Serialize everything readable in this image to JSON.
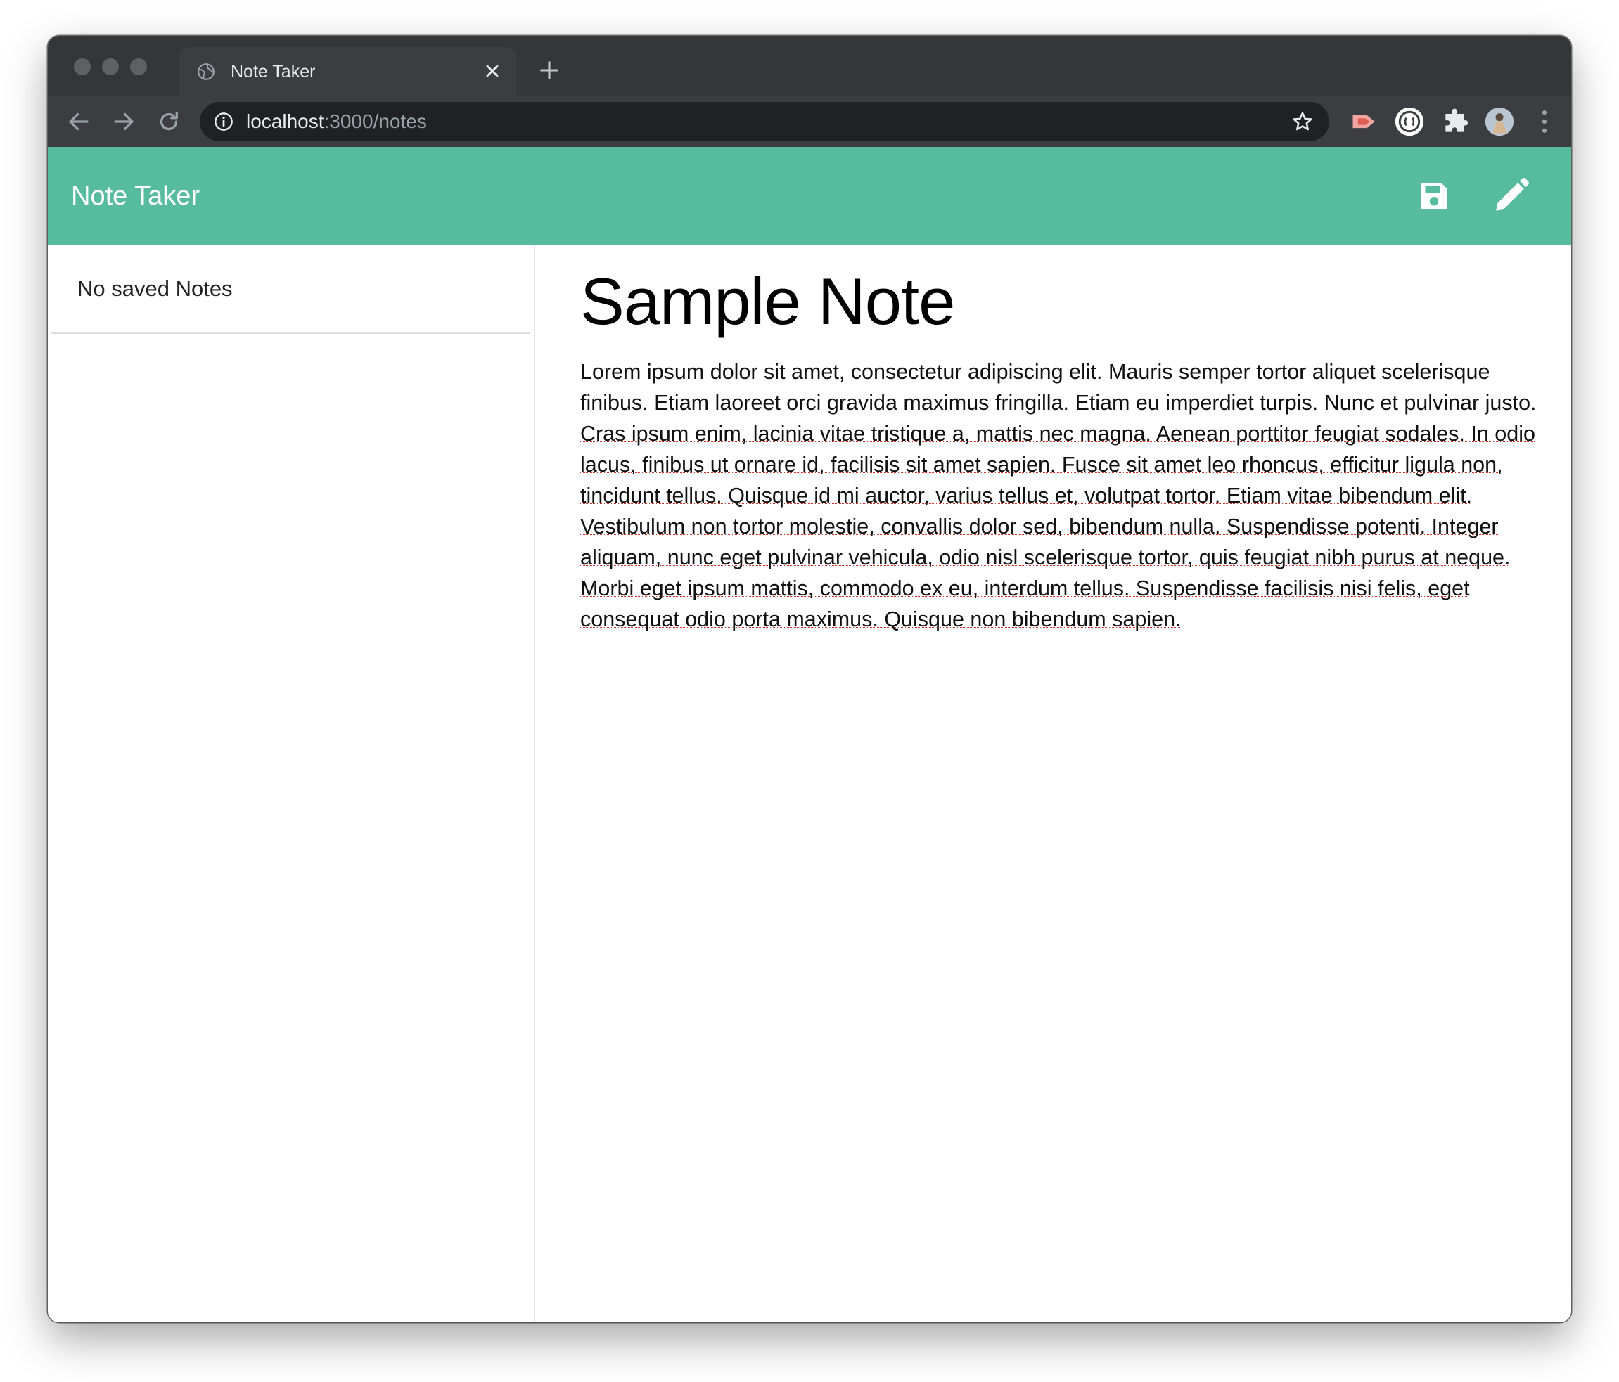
{
  "browser": {
    "tab_title": "Note Taker",
    "url_host": "localhost",
    "url_path": ":3000/notes"
  },
  "app": {
    "brand": "Note Taker",
    "accent_color": "#57bb9e",
    "icons": [
      "save-icon",
      "pencil-icon"
    ]
  },
  "sidebar": {
    "empty_message": "No saved Notes"
  },
  "note": {
    "title": "Sample Note",
    "body": "Lorem ipsum dolor sit amet, consectetur adipiscing elit. Mauris semper tortor aliquet scelerisque finibus. Etiam laoreet orci gravida maximus fringilla. Etiam eu imperdiet turpis. Nunc et pulvinar justo. Cras ipsum enim, lacinia vitae tristique a, mattis nec magna. Aenean porttitor feugiat sodales. In odio lacus, finibus ut ornare id, facilisis sit amet sapien. Fusce sit amet leo rhoncus, efficitur ligula non, tincidunt tellus. Quisque id mi auctor, varius tellus et, volutpat tortor. Etiam vitae bibendum elit. Vestibulum non tortor molestie, convallis dolor sed, bibendum nulla. Suspendisse potenti. Integer aliquam, nunc eget pulvinar vehicula, odio nisl scelerisque tortor, quis feugiat nibh purus at neque. Morbi eget ipsum mattis, commodo ex eu, interdum tellus. Suspendisse facilisis nisi felis, eget consequat odio porta maximus. Quisque non bibendum sapien."
  }
}
